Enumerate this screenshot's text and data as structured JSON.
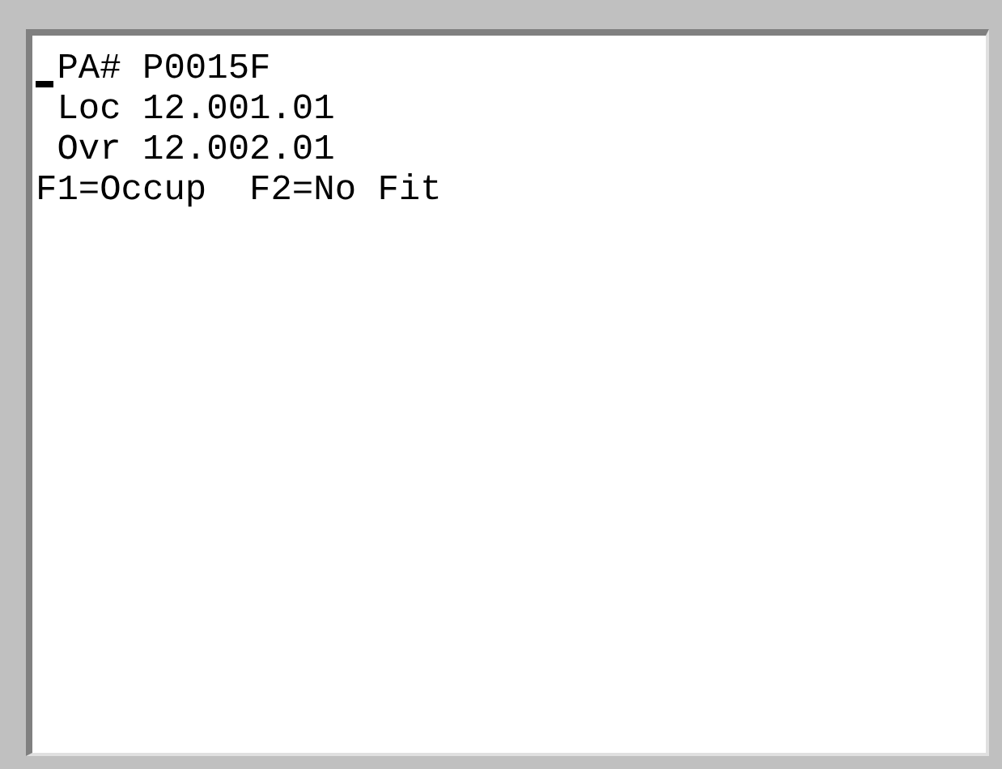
{
  "screen": {
    "lines": [
      {
        "text": " PA# P0015F",
        "cursor": true
      },
      {
        "text": " Loc 12.001.01",
        "cursor": false
      },
      {
        "text": " Ovr 12.002.01",
        "cursor": false
      },
      {
        "text": "F1=Occup  F2=No Fit",
        "cursor": false
      }
    ]
  }
}
